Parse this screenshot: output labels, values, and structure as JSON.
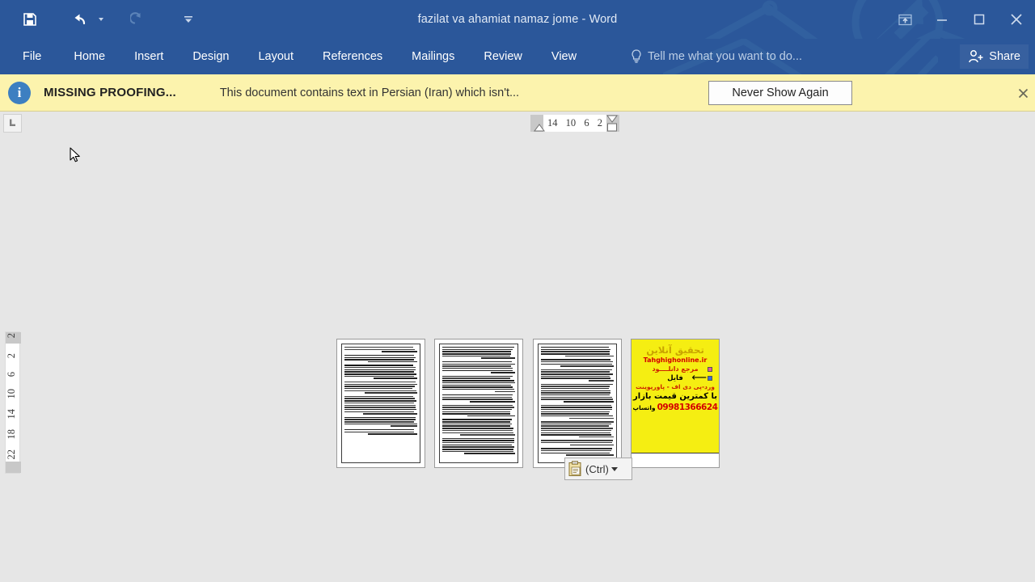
{
  "window": {
    "title": "fazilat va ahamiat namaz jome - Word",
    "quick_access": [
      {
        "name": "save",
        "icon": "save-icon"
      },
      {
        "name": "undo",
        "icon": "undo-icon"
      },
      {
        "name": "undo-dropdown",
        "icon": "chevron-down-icon"
      },
      {
        "name": "redo",
        "icon": "redo-icon"
      },
      {
        "name": "customize-quick-access",
        "icon": "chevron-down-icon"
      }
    ],
    "controls": [
      {
        "name": "ribbon-display-options",
        "icon": "ribbon-display-icon",
        "glyph": "⬆"
      },
      {
        "name": "minimize",
        "icon": "minimize-icon",
        "glyph": "—"
      },
      {
        "name": "restore",
        "icon": "restore-icon",
        "glyph": "❑"
      },
      {
        "name": "close",
        "icon": "close-icon",
        "glyph": "✕"
      }
    ]
  },
  "ribbon": {
    "tabs": [
      {
        "label": "File"
      },
      {
        "label": "Home"
      },
      {
        "label": "Insert"
      },
      {
        "label": "Design"
      },
      {
        "label": "Layout"
      },
      {
        "label": "References"
      },
      {
        "label": "Mailings"
      },
      {
        "label": "Review"
      },
      {
        "label": "View"
      }
    ],
    "tell_me": "Tell me what you want to do...",
    "share_label": "Share",
    "accent_color": "#2b579a"
  },
  "message_bar": {
    "icon": "info-icon",
    "title": "MISSING PROOFING...",
    "text": "This document contains text in Persian (Iran) which isn't...",
    "button_label": "Never Show Again",
    "close_icon": "close-icon",
    "background_color": "#fcf3ad"
  },
  "rulers": {
    "tab_selector_glyph": "L",
    "horizontal_numbers": [
      "14",
      "10",
      "6",
      "2"
    ],
    "vertical_numbers": [
      "2",
      "2",
      "6",
      "10",
      "14",
      "18",
      "22"
    ]
  },
  "document": {
    "pages": [
      {
        "name": "page-1",
        "kind": "text"
      },
      {
        "name": "page-2",
        "kind": "text"
      },
      {
        "name": "page-3",
        "kind": "text"
      },
      {
        "name": "page-4",
        "kind": "advertisement"
      }
    ],
    "advertisement": {
      "heading": "تحقیق آنلاین",
      "url": "Tahghighonline.ir",
      "line1": "مرجع دانلــــود",
      "line2": "فایل",
      "line3": "ورد-پی دی اف - پاورپوینت",
      "line4": "با کمترین قیمت بازار",
      "phone": "09981366624",
      "whatsapp": "واتساپ",
      "background_color": "#f5ee12"
    }
  },
  "paste_options": {
    "label": "(Ctrl)",
    "icon": "clipboard-icon",
    "caret_icon": "chevron-down-icon"
  },
  "cursor": {
    "icon": "arrow-cursor-icon"
  }
}
